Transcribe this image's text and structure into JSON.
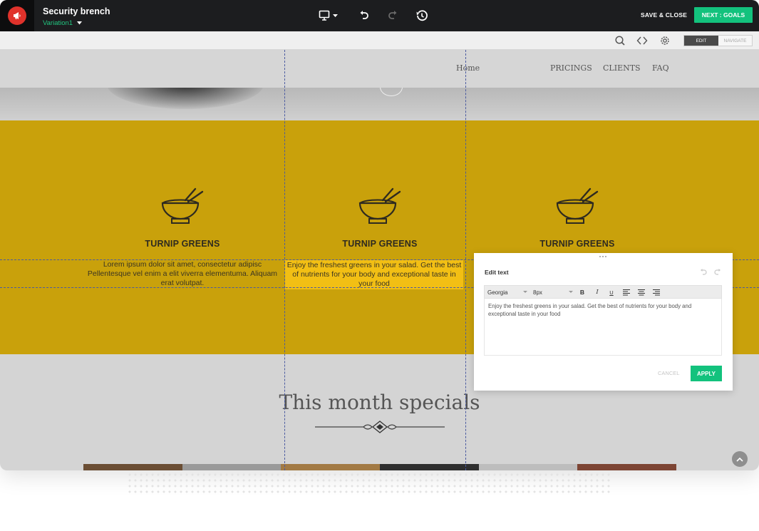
{
  "topbar": {
    "project_title": "Security brench",
    "variation": "Variation1",
    "save_close": "SAVE & CLOSE",
    "next_goals": "NEXT : GOALS"
  },
  "toolbar": {
    "mode_edit": "EDIT",
    "mode_navigate": "NAVIGATE"
  },
  "site": {
    "nav": [
      "Home",
      "PRICINGS",
      "CLIENTS",
      "FAQ"
    ],
    "features": [
      {
        "title": "TURNIP GREENS",
        "text": "Lorem ipsum dolor sit amet, consectetur adipisc Pellentesque vel enim a elit viverra elementuma. Aliquam erat volutpat."
      },
      {
        "title": "TURNIP GREENS",
        "text": "Enjoy the freshest greens in your salad. Get the best of nutrients for your body and exceptional taste in your food"
      },
      {
        "title": "TURNIP GREENS",
        "text": ""
      }
    ],
    "specials_title": "This month specials"
  },
  "edit_panel": {
    "title": "Edit text",
    "font": "Georgia",
    "size": "8px",
    "bold": "B",
    "italic": "I",
    "underline": "U",
    "content": "Enjoy the freshest greens in your salad. Get the best of nutrients for your body and exceptional taste in your food",
    "cancel": "CANCEL",
    "apply": "APPLY"
  },
  "colors": {
    "accent_green": "#13c27d",
    "section_yellow": "#c9a10b",
    "selection_yellow": "#f2bf14",
    "topbar_dark": "#1c1d1f",
    "logo_red": "#e0322b"
  },
  "icons": {
    "logo": "megaphone-icon",
    "device": "desktop-icon",
    "undo": "undo-icon",
    "redo": "redo-icon",
    "history": "history-icon",
    "search": "search-icon",
    "code": "code-icon",
    "settings": "gear-icon",
    "feature": "bowl-chopsticks-icon"
  }
}
